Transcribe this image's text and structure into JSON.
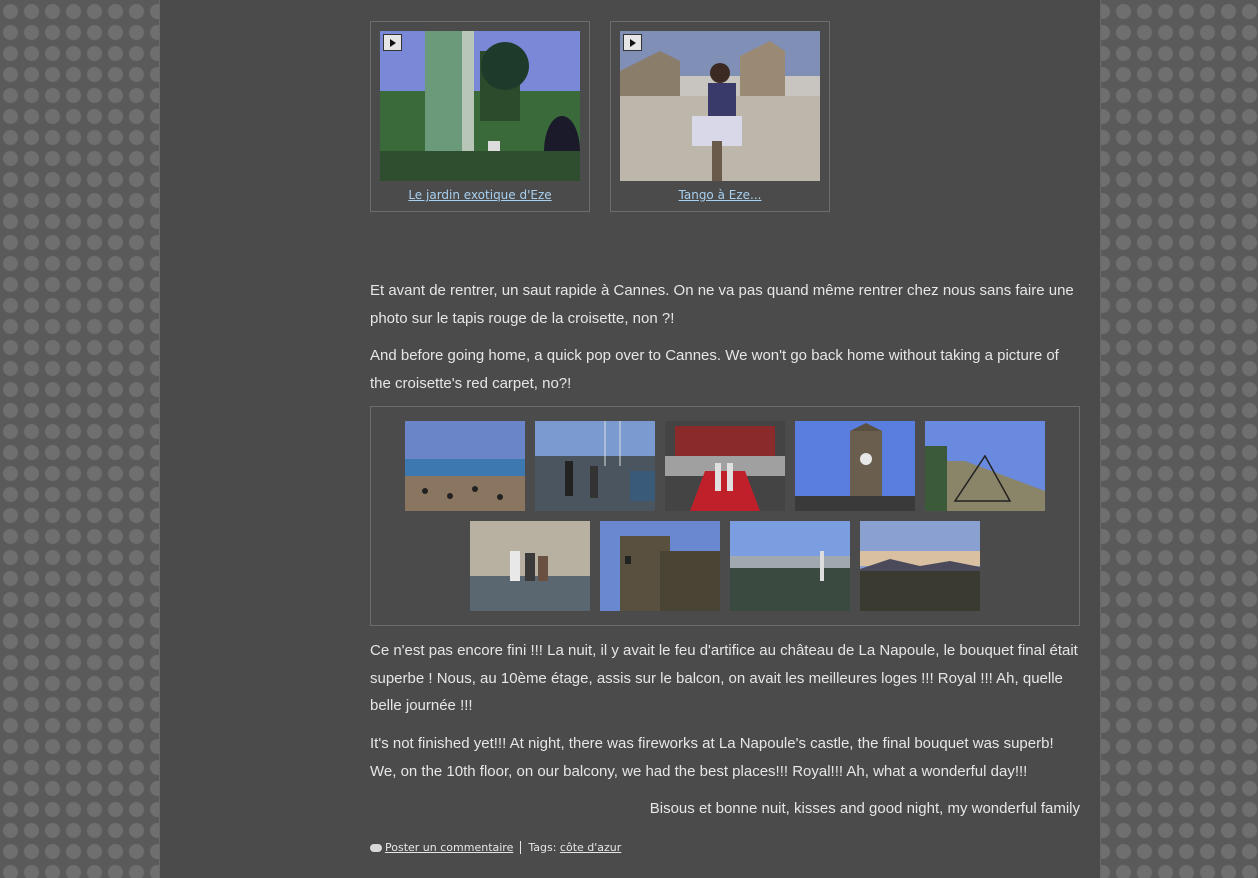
{
  "videos": [
    {
      "title": "Le jardin exotique d'Eze"
    },
    {
      "title": "Tango à Eze..."
    }
  ],
  "paragraphs": {
    "cannes_fr": "Et avant de rentrer, un saut rapide à Cannes. On ne va pas quand même rentrer chez nous sans faire une photo sur le tapis rouge de la croisette, non ?!",
    "cannes_en": "And before going home, a quick pop over to Cannes. We won't go back home without taking a picture of the croisette's red carpet, no?!",
    "night_fr": "Ce n'est pas encore fini !!! La nuit, il y avait le feu d'artifice au château de La Napoule, le bouquet final était superbe ! Nous, au 10ème étage, assis sur le balcon, on avait les meilleures loges !!! Royal !!! Ah, quelle belle journée !!!",
    "night_en": "It's not finished yet!!! At night, there was fireworks at La Napoule's castle, the final bouquet was superb! We, on the 10th floor, on our balcony, we had the best places!!! Royal!!! Ah, what a wonderful day!!!",
    "signoff": "Bisous et bonne nuit, kisses and good night, my wonderful family"
  },
  "gallery": {
    "photos": [
      "beach",
      "harbour",
      "red-carpet",
      "clock-tower",
      "fortress-stairs",
      "stone-wall",
      "castle-tower",
      "harbour-view",
      "sunset-bay"
    ]
  },
  "footer": {
    "comment_link": "Poster un commentaire",
    "tags_label": "Tags:",
    "tag": "côte d'azur"
  },
  "colors": {
    "page_bg": "#4b4b4b",
    "text": "#e6e6e6",
    "link": "#a8d0f0"
  }
}
